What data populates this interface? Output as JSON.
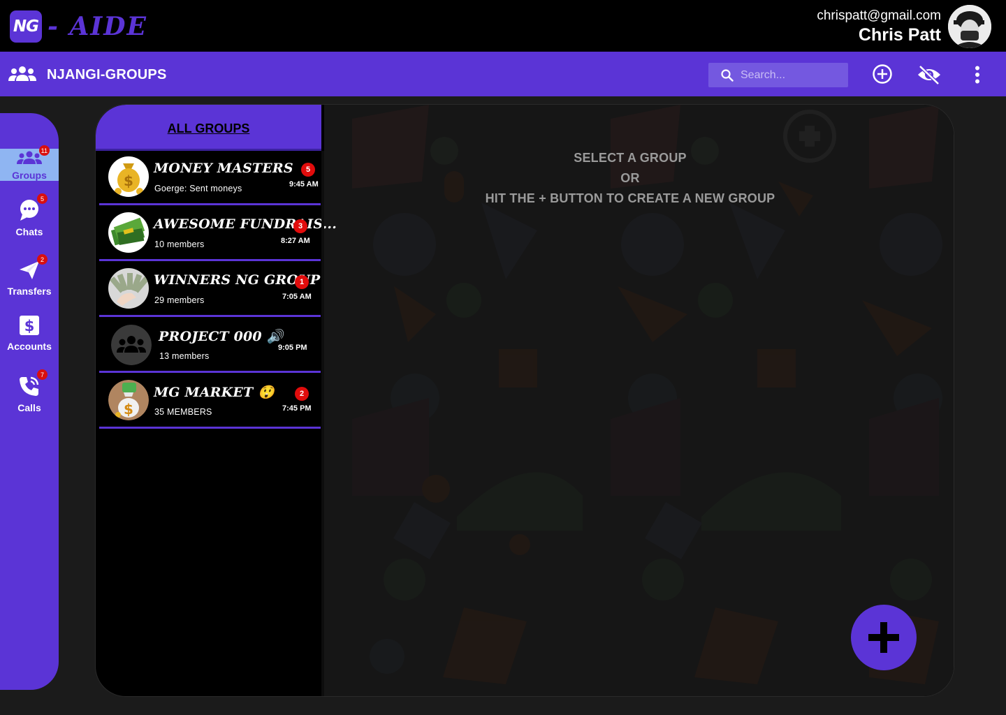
{
  "app": {
    "logo_badge": "NG",
    "logo_text": "- AIDE"
  },
  "user": {
    "email": "chrispatt@gmail.com",
    "name": "Chris Patt"
  },
  "header": {
    "title": "NJANGI-GROUPS",
    "search_placeholder": "Search..."
  },
  "sidebar": {
    "items": [
      {
        "label": "Groups",
        "badge": "11",
        "icon": "groups-icon",
        "active": true
      },
      {
        "label": "Chats",
        "badge": "5",
        "icon": "chat-icon"
      },
      {
        "label": "Transfers",
        "badge": "2",
        "icon": "send-icon"
      },
      {
        "label": "Accounts",
        "badge": "",
        "icon": "dollar-icon"
      },
      {
        "label": "Calls",
        "badge": "7",
        "icon": "phone-icon"
      }
    ]
  },
  "groups_list": {
    "title": "ALL GROUPS",
    "items": [
      {
        "name": "MONEY MASTERS",
        "subtitle": "Goerge: Sent moneys",
        "badge": "5",
        "time": "9:45 AM"
      },
      {
        "name": "AWESOME FUNDRAIS...",
        "subtitle": "10 members",
        "badge": "3",
        "time": "8:27 AM"
      },
      {
        "name": "WINNERS NG GROUP",
        "subtitle": "29 members",
        "badge": "1",
        "time": "7:05 AM"
      },
      {
        "name": "PROJECT 000 🔊",
        "subtitle": "13 members",
        "badge": "",
        "time": "9:05 PM"
      },
      {
        "name": "MG MARKET 😲",
        "subtitle": "35 MEMBERS",
        "badge": "2",
        "time": "7:45 PM"
      }
    ]
  },
  "content": {
    "line1": "SELECT A GROUP",
    "line2": "OR",
    "line3": "HIT THE + BUTTON TO CREATE A NEW GROUP"
  },
  "colors": {
    "accent": "#5b34d6",
    "badge": "#e10c0c",
    "active_nav": "#8fb5f2"
  }
}
